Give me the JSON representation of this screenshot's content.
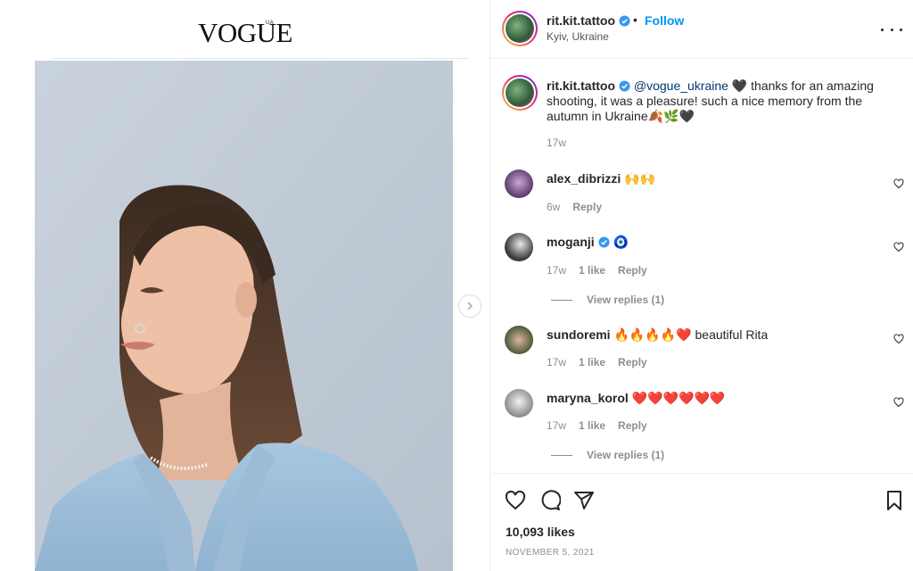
{
  "media": {
    "logo": "VOGUE",
    "logo_sub": "UA"
  },
  "post": {
    "username": "rit.kit.tattoo",
    "follow_label": "Follow",
    "dot": "•",
    "location": "Kyiv, Ukraine",
    "caption": {
      "username": "rit.kit.tattoo",
      "mention": "@vogue_ukraine",
      "text": " 🖤 thanks for an amazing shooting, it was a pleasure! such a nice memory from the autumn in Ukraine🍂🌿🖤",
      "age": "17w"
    },
    "comments": [
      {
        "username": "alex_dibrizzi",
        "text": "🙌🙌",
        "age": "6w",
        "likes": "",
        "reply_label": "Reply",
        "view_replies": "",
        "avatar_color": "#7c5a8a"
      },
      {
        "username": "moganji",
        "text": "🧿",
        "age": "17w",
        "likes": "1 like",
        "reply_label": "Reply",
        "view_replies": "View replies (1)",
        "avatar_color": "#3a3a3a"
      },
      {
        "username": "sundoremi",
        "text": "🔥🔥🔥🔥❤️ beautiful Rita",
        "age": "17w",
        "likes": "1 like",
        "reply_label": "Reply",
        "view_replies": "",
        "avatar_color": "#6b7a5a"
      },
      {
        "username": "maryna_korol",
        "text": "❤️❤️❤️❤️❤️❤️",
        "age": "17w",
        "likes": "1 like",
        "reply_label": "Reply",
        "view_replies": "View replies (1)",
        "avatar_color": "#9a9a9a"
      }
    ],
    "likes": "10,093 likes",
    "date": "NOVEMBER 5, 2021"
  },
  "icons": {
    "like": "heart-icon",
    "comment": "comment-icon",
    "share": "share-icon",
    "save": "bookmark-icon",
    "more": "more-icon",
    "verified": "verified-badge-icon",
    "next": "chevron-right-icon"
  },
  "colors": {
    "link": "#0095f6",
    "mention": "#00376b",
    "verified": "#3897f0",
    "secondary_text": "#8e8e8e"
  }
}
